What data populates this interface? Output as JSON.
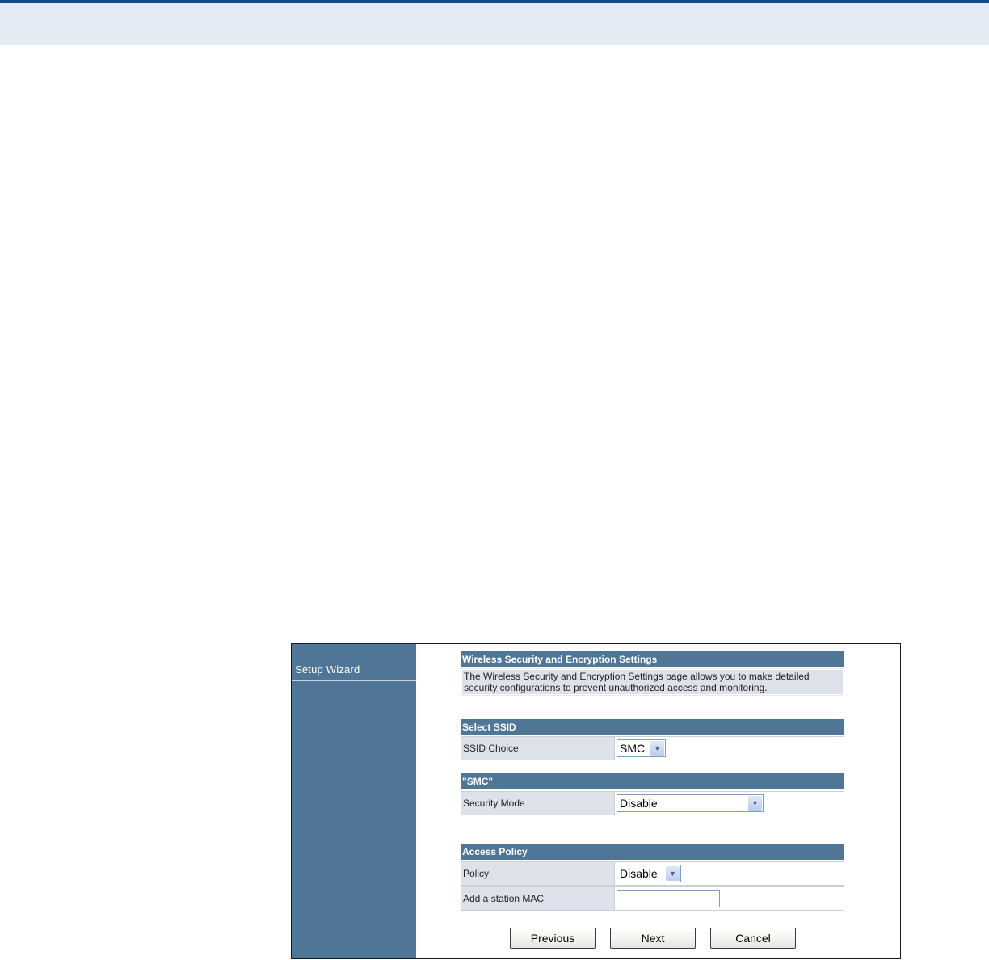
{
  "sidebar": {
    "items": [
      {
        "label": "Setup Wizard"
      }
    ]
  },
  "wireless_security": {
    "title": "Wireless Security and Encryption Settings",
    "description": "The Wireless Security and Encryption Settings page allows you to make detailed security configurations to prevent unauthorized access and monitoring."
  },
  "select_ssid": {
    "title": "Select SSID",
    "ssid_choice_label": "SSID Choice",
    "ssid_choice_value": "SMC"
  },
  "ssid_section": {
    "title": "\"SMC\"",
    "security_mode_label": "Security Mode",
    "security_mode_value": "Disable"
  },
  "access_policy": {
    "title": "Access Policy",
    "policy_label": "Policy",
    "policy_value": "Disable",
    "station_mac_label": "Add a station MAC",
    "station_mac_value": ""
  },
  "buttons": {
    "previous": "Previous",
    "next": "Next",
    "cancel": "Cancel"
  },
  "colors": {
    "header_blue": "#4f7597",
    "label_gray": "#dde2ea",
    "top_rule": "#0a4b8c"
  }
}
